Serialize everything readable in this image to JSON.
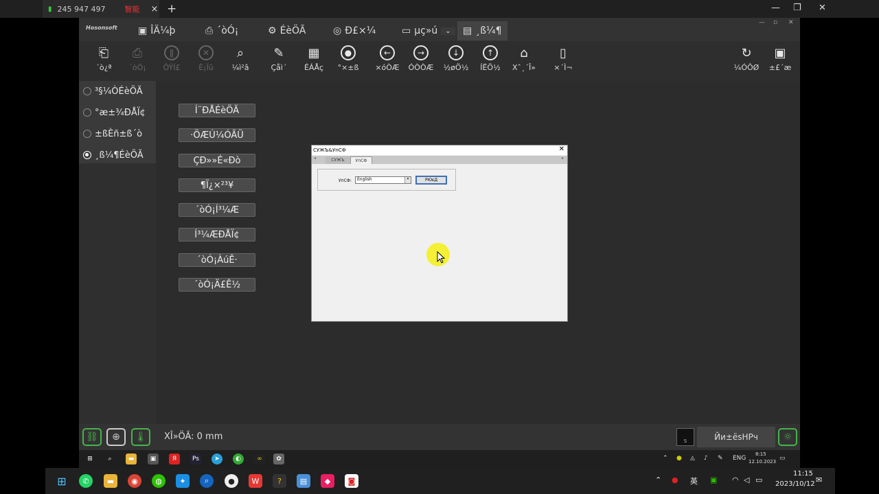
{
  "browser": {
    "signal_label": "245 947 497",
    "red_label": "智能",
    "close": "×",
    "new_tab": "+",
    "minimize": "—",
    "maximize": "❐",
    "close_window": "✕"
  },
  "app": {
    "logo": "Hosonsoft",
    "menus": [
      {
        "label": "ÎÄ¼þ",
        "icon": "clipboard-icon"
      },
      {
        "label": "´òÓ¡",
        "icon": "printer-icon"
      },
      {
        "label": "ÉèÖÃ",
        "icon": "gear-icon"
      },
      {
        "label": "Ð£×¼",
        "icon": "target-icon"
      },
      {
        "label": "µç»ú",
        "icon": "battery-icon"
      },
      {
        "label": "¸ß¼¶",
        "icon": "document-list-icon"
      }
    ],
    "toolbar": [
      {
        "label": "´ò¿ª",
        "icon": "open-icon",
        "enabled": true
      },
      {
        "label": "´òÓ¡",
        "icon": "printer-icon",
        "enabled": false
      },
      {
        "label": "ÔÝÍ£",
        "icon": "pause-icon",
        "enabled": false
      },
      {
        "label": "È¡Ïû",
        "icon": "cancel-icon",
        "enabled": false
      },
      {
        "label": "¼ì²â",
        "icon": "search-doc-icon",
        "enabled": true
      },
      {
        "label": "Çåì´",
        "icon": "brush-icon",
        "enabled": true
      },
      {
        "label": "ÉÁÅç",
        "icon": "grid-icon",
        "enabled": true
      },
      {
        "label": "°×±ß",
        "icon": "crosshair-icon",
        "enabled": true
      },
      {
        "label": "×óÒÆ",
        "icon": "arrow-left-icon",
        "enabled": true
      },
      {
        "label": "ÓÒÒÆ",
        "icon": "arrow-right-icon",
        "enabled": true
      },
      {
        "label": "½øÖ½",
        "icon": "arrow-down-icon",
        "enabled": true
      },
      {
        "label": "ÍËÖ½",
        "icon": "arrow-up-icon",
        "enabled": true
      },
      {
        "label": "Xˆ¸´Î»",
        "icon": "home-icon",
        "enabled": true
      },
      {
        "label": "×´Ì¬",
        "icon": "page-icon",
        "enabled": true
      }
    ],
    "toolbar_right": [
      {
        "label": "¼ÓÔØ",
        "icon": "refresh-icon"
      },
      {
        "label": "±£´æ",
        "icon": "save-icon"
      }
    ],
    "sidebar": [
      {
        "label": "³§¼ÒÉèÖÃ",
        "selected": false
      },
      {
        "label": "°æ±¾ÐÅÏ¢",
        "selected": false
      },
      {
        "label": "±ßÈñ±ß´ò",
        "selected": false
      },
      {
        "label": "¸ß¼¶ÉèÖÃ",
        "selected": true
      }
    ],
    "panel_buttons": [
      "Í¨ÐÅÉèÖÃ",
      "·ÖÆÚ¼ÓÃÜ",
      "ÇÐ»»É«Ðò",
      "¶Ï¿×²³¥",
      "´òÓ¡Í³¼Æ",
      "Í³¼ÆÐÅÏ¢",
      "´òÓ¡ÀúÊ·",
      "´òÓ¡Ä£Ê½"
    ],
    "dialog": {
      "title": "СУЖЪ&УпСФ",
      "close": "✕",
      "tabs": [
        "СУЖЪ",
        "УпСФ"
      ],
      "language_label": "УпСФ:",
      "language_value": "English",
      "apply_label": "PЮєД"
    },
    "status": {
      "position_text": "XÎ»ÖÃ: 0 mm",
      "device_label": "S",
      "right_label": "Йи±ёsНРч"
    }
  },
  "vm_taskbar": {
    "lang": "ENG",
    "time": "8:15",
    "date": "12.10.2023"
  },
  "host_taskbar": {
    "ime": "英",
    "time": "11:15",
    "date": "2023/10/12"
  }
}
